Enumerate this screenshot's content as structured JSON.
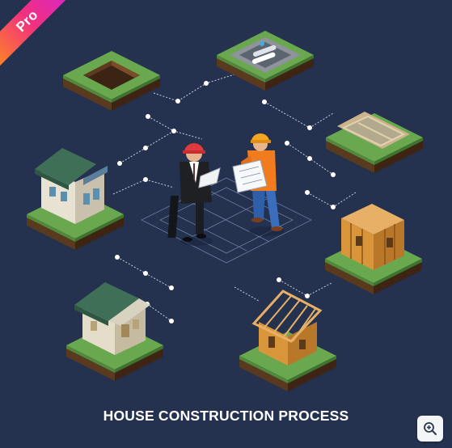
{
  "badge": {
    "label": "Pro"
  },
  "illustration": {
    "caption": "HOUSE CONSTRUCTION PROCESS"
  },
  "controls": {
    "zoom_icon": "zoom-in-icon"
  },
  "colors": {
    "background": "#24314f",
    "grass": "#6aa84f",
    "soil": "#6b4423",
    "roof": "#3f6f57",
    "timber": "#d9953a",
    "accent_orange": "#f07c1e",
    "helmet_red": "#e0393e"
  }
}
